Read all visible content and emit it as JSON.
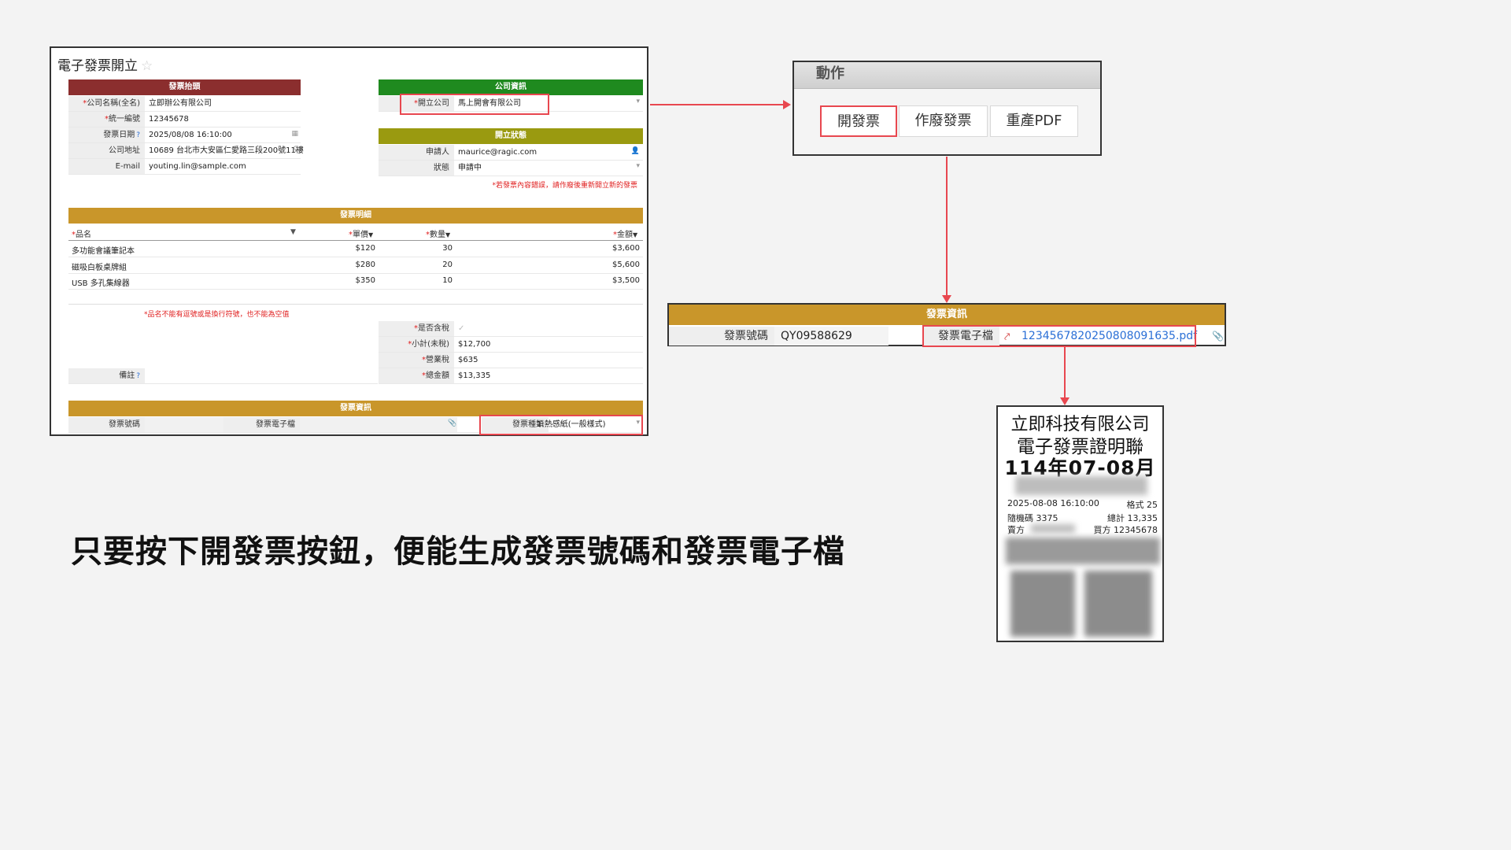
{
  "form": {
    "title": "電子發票開立",
    "star_icon": "star-icon",
    "header_section": {
      "title": "發票抬頭",
      "color": "#8b2e2e",
      "rows": [
        {
          "label": "公司名稱(全名)",
          "required": "*",
          "value": "立即辦公有限公司"
        },
        {
          "label": "統一編號",
          "required": "*",
          "value": "12345678"
        },
        {
          "label": "發票日期",
          "help": "?",
          "value": "2025/08/08 16:10:00"
        },
        {
          "label": "公司地址",
          "value": "10689 台北市大安區仁愛路三段200號11樓"
        },
        {
          "label": "E-mail",
          "value": "youting.lin@sample.com"
        }
      ]
    },
    "company_section": {
      "title": "公司資訊",
      "color": "#1f8a1f",
      "rows": [
        {
          "label": "開立公司",
          "required": "*",
          "value": "馬上開會有限公司"
        }
      ]
    },
    "status_section": {
      "title": "開立狀態",
      "color": "#9a9a10",
      "rows": [
        {
          "label": "申請人",
          "value": "maurice@ragic.com"
        },
        {
          "label": "狀態",
          "value": "申請中"
        }
      ],
      "note": "*若發票內容錯誤，請作廢後重新開立新的發票"
    },
    "detail_section": {
      "title": "發票明細",
      "color": "#c9962a",
      "columns": {
        "name": "品名",
        "price": "單價",
        "qty": "數量",
        "amount": "金額"
      },
      "rows": [
        {
          "name": "多功能會議筆記本",
          "price": "$120",
          "qty": "30",
          "amount": "$3,600"
        },
        {
          "name": "磁吸白板桌牌組",
          "price": "$280",
          "qty": "20",
          "amount": "$5,600"
        },
        {
          "name": "USB 多孔集線器",
          "price": "$350",
          "qty": "10",
          "amount": "$3,500"
        }
      ],
      "note": "*品名不能有逗號或是換行符號，也不能為空值"
    },
    "totals": {
      "rows": [
        {
          "label": "是否含稅",
          "required": "*",
          "value": "✓"
        },
        {
          "label": "小計(未稅)",
          "required": "*",
          "value": "$12,700"
        },
        {
          "label": "營業稅",
          "required": "*",
          "value": "$635"
        },
        {
          "label": "總金額",
          "required": "*",
          "value": "$13,335"
        }
      ],
      "remark_label": "備註",
      "remark_help": "?"
    },
    "invoice_section": {
      "title": "發票資訊",
      "color": "#c9962a",
      "number_label": "發票號碼",
      "file_label": "發票電子檔",
      "type_label": "發票種類",
      "type_value": "1:熱感紙(一般樣式)"
    }
  },
  "actions": {
    "title": "動作",
    "buttons": [
      "開發票",
      "作廢發票",
      "重產PDF"
    ]
  },
  "invoice_strip": {
    "title": "發票資訊",
    "number_label": "發票號碼",
    "number_value": "QY09588629",
    "file_label": "發票電子檔",
    "file_value": "1234567820250808091635.pdf",
    "pdf_icon": "pdf-icon",
    "clip_icon": "paperclip-icon"
  },
  "receipt": {
    "company": "立即科技有限公司",
    "title": "電子發票證明聯",
    "period": "114年07-08月",
    "datetime": "2025-08-08 16:10:00",
    "format": "格式 25",
    "random_code": "隨機碼 3375",
    "total": "總計 13,335",
    "seller": "賣方",
    "buyer": "買方 12345678"
  },
  "caption": "只要按下開發票按鈕，便能生成發票號碼和發票電子檔",
  "colors": {
    "highlight": "#e8474f",
    "link": "#2a6fd6"
  }
}
